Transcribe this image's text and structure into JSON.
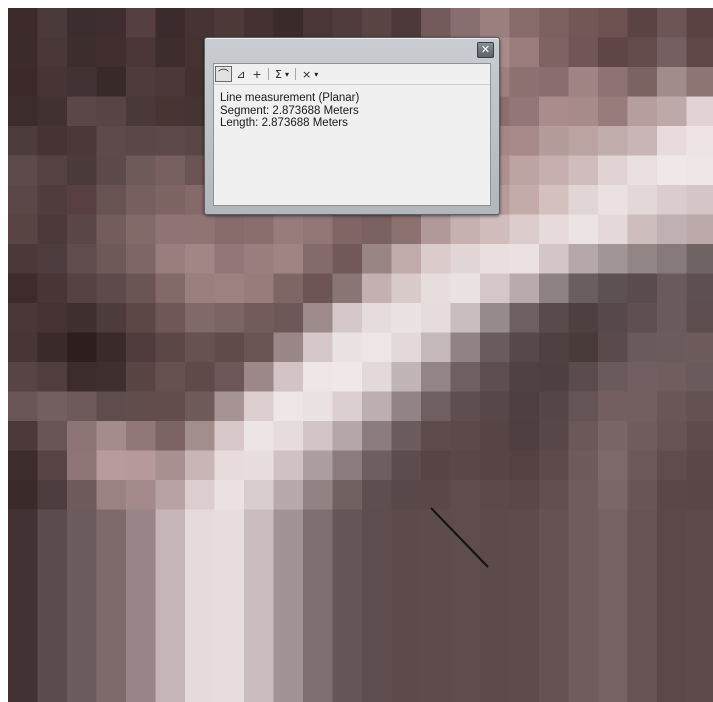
{
  "measure_window": {
    "close_glyph": "✕",
    "toolbar": {
      "line_tool_glyph": "⌒",
      "area_tool_glyph": "⊿",
      "feature_tool_glyph": "+",
      "sum_glyph": "Σ",
      "dropdown_glyph": "▾",
      "clear_glyph": "×"
    },
    "results": {
      "title": "Line measurement (Planar)",
      "segment": "Segment: 2.873688 Meters",
      "length": "Length: 2.873688 Meters"
    }
  },
  "map": {
    "cell_colors": [
      "#3d2b2b",
      "#4b3a3a",
      "#3b2c2d",
      "#3f2e2f",
      "#553f40",
      "#3c2b2c",
      "#463434",
      "#4f3a3a",
      "#443233",
      "#3a2b2a",
      "#4a3636",
      "#503c3c",
      "#5a4444",
      "#4e3a3a",
      "#735b5c",
      "#896e6f",
      "#9b7f7f",
      "#876a6a",
      "#7d6060",
      "#735656",
      "#6d5050",
      "#5b4344",
      "#6d5556",
      "#5a4243",
      "#3b2b2b",
      "#4a3839",
      "#3d2d2d",
      "#412f30",
      "#4a3636",
      "#3e2d2d",
      "#453333",
      "#4e3939",
      "#433132",
      "#3c2c2c",
      "#4d3939",
      "#4e3a3b",
      "#574141",
      "#564041",
      "#6e5555",
      "#8b6e6e",
      "#a78a89",
      "#9b7c7c",
      "#7f6363",
      "#725556",
      "#5f4546",
      "#634a4b",
      "#765f60",
      "#5f4748",
      "#3c2a2b",
      "#473536",
      "#433233",
      "#392a2a",
      "#4e3c3c",
      "#4b3838",
      "#433132",
      "#4e3a3a",
      "#4b3838",
      "#4a3737",
      "#574242",
      "#5d4646",
      "#5b4545",
      "#6b5353",
      "#7b6060",
      "#927575",
      "#9d8181",
      "#8d7171",
      "#8a6d6e",
      "#a18585",
      "#8f7374",
      "#7d6262",
      "#a18b8b",
      "#8d7574",
      "#3d2c2c",
      "#413131",
      "#5a4747",
      "#574444",
      "#4a3939",
      "#473534",
      "#453434",
      "#4f3b3b",
      "#533f3f",
      "#5b4545",
      "#594343",
      "#5d4747",
      "#735a5a",
      "#634c4c",
      "#6a5252",
      "#7f6465",
      "#8b6f6f",
      "#937677",
      "#a98c8b",
      "#a78b8a",
      "#987c7b",
      "#b69e9e",
      "#bca9a8",
      "#e2d2d3",
      "#4d3c3c",
      "#463434",
      "#4b3939",
      "#5e4a4a",
      "#5a4747",
      "#5c4848",
      "#5a4646",
      "#5a4646",
      "#5c4747",
      "#694f4f",
      "#665050",
      "#6c5555",
      "#765d5d",
      "#7d6262",
      "#866a69",
      "#9d8181",
      "#a48786",
      "#a78a89",
      "#b59c9b",
      "#bba3a2",
      "#c1adac",
      "#c8b6b6",
      "#e9dbdc",
      "#efe4e5",
      "#5d4b4b",
      "#544242",
      "#4c3b3b",
      "#5c4949",
      "#6f5a5a",
      "#786060",
      "#6b5454",
      "#6e5656",
      "#755c5c",
      "#7d6161",
      "#7b6060",
      "#846869",
      "#8d7070",
      "#9c7f7f",
      "#a58888",
      "#a68988",
      "#ad9191",
      "#bda3a2",
      "#c6afae",
      "#cfbcbc",
      "#e1d3d3",
      "#eae0e0",
      "#f0e7e7",
      "#eee5e6",
      "#5b4747",
      "#4f3d3d",
      "#583f41",
      "#685353",
      "#785f5f",
      "#7f6464",
      "#866a6a",
      "#7a5f5f",
      "#7b6161",
      "#856968",
      "#7b6061",
      "#7f6464",
      "#856969",
      "#9e8282",
      "#b49898",
      "#ad9292",
      "#b69b9b",
      "#c4abaa",
      "#d3c0bf",
      "#e2d5d6",
      "#ebe1e2",
      "#e4d7d8",
      "#dbcccd",
      "#d5c5c6",
      "#5a4545",
      "#4c3a3b",
      "#5a4647",
      "#745c5c",
      "#846969",
      "#907374",
      "#907473",
      "#876b6b",
      "#8a6e6e",
      "#987b7b",
      "#927676",
      "#816565",
      "#7c6162",
      "#8d7170",
      "#b1999a",
      "#c6b0b0",
      "#d0bcbb",
      "#ddcccc",
      "#e6dada",
      "#ece3e3",
      "#e4d8d9",
      "#cdbdbd",
      "#c1b0b1",
      "#bca9aa",
      "#4b3839",
      "#4e3d3e",
      "#5f4c4c",
      "#6f5858",
      "#806566",
      "#9a7d7d",
      "#a28585",
      "#937677",
      "#9a7e7e",
      "#a08383",
      "#856a6b",
      "#735a5a",
      "#9a8585",
      "#c0aaaa",
      "#dccbcb",
      "#e3d6d6",
      "#e9dfe0",
      "#ebe1e2",
      "#d4c6c7",
      "#b6a7a8",
      "#a19595",
      "#928585",
      "#867a7b",
      "#6f6364",
      "#3e2c2c",
      "#483536",
      "#554242",
      "#5d4a4a",
      "#6b5454",
      "#846969",
      "#9b7e7e",
      "#9d8181",
      "#987c7c",
      "#7f6564",
      "#6d5556",
      "#8a7575",
      "#c3b0b0",
      "#dacbcb",
      "#e8dddd",
      "#ebe2e2",
      "#d5c7c8",
      "#b9aaab",
      "#8e8182",
      "#6b5e5f",
      "#5e5151",
      "#5a4b4c",
      "#6a5a5b",
      "#5e4f50",
      "#4a3839",
      "#453334",
      "#3f2f2f",
      "#4d3c3c",
      "#5c4646",
      "#6f5757",
      "#816869",
      "#7d6464",
      "#735b5b",
      "#6e5757",
      "#9d8a8a",
      "#d6c8c8",
      "#e6dcdc",
      "#ebe2e3",
      "#e6dcdd",
      "#c9bcbc",
      "#978a8a",
      "#6e6061",
      "#594b4c",
      "#4e3f40",
      "#574849",
      "#5f4f50",
      "#6b5a5b",
      "#5d4d4e",
      "#483636",
      "#3a2a29",
      "#2e1f1e",
      "#3a2a29",
      "#4f3d3d",
      "#5c4747",
      "#685151",
      "#614a4a",
      "#6a5454",
      "#9a8787",
      "#d5c7c7",
      "#ebe2e2",
      "#ede5e6",
      "#e4d9da",
      "#c5b8b9",
      "#918383",
      "#6a5c5d",
      "#574949",
      "#4f4041",
      "#4a3b3b",
      "#5a4a4b",
      "#6b5a5b",
      "#6c5b5c",
      "#6e5c5d",
      "#574546",
      "#503e3e",
      "#3c2c2b",
      "#3f2f2e",
      "#5a4545",
      "#665050",
      "#5f4949",
      "#6c5657",
      "#9c8889",
      "#d3c3c4",
      "#eee5e6",
      "#efe7e8",
      "#e3d9da",
      "#c2b5b6",
      "#938586",
      "#705f60",
      "#5e4e4f",
      "#504142",
      "#4e3f40",
      "#5b4b4c",
      "#6a5a5b",
      "#725f61",
      "#705e5f",
      "#6b5a5b",
      "#6a5657",
      "#735f60",
      "#6e5a5b",
      "#5f4c4d",
      "#624d4d",
      "#624c4c",
      "#705b5b",
      "#a69394",
      "#dccdce",
      "#eee6e7",
      "#ebe2e3",
      "#dccfd0",
      "#bdaeaf",
      "#928384",
      "#6f5f60",
      "#5f4e4f",
      "#574748",
      "#4f3f40",
      "#564647",
      "#655455",
      "#735f60",
      "#725f60",
      "#695758",
      "#645252",
      "#4c3a3a",
      "#6a5556",
      "#8d7576",
      "#a58b8c",
      "#927778",
      "#7c6465",
      "#a38e8e",
      "#d8c8c9",
      "#ede4e5",
      "#e6dcdd",
      "#d3c5c6",
      "#b5a6a7",
      "#8c7c7d",
      "#6d5c5d",
      "#5e4c4d",
      "#5c4a4b",
      "#574546",
      "#4f3e3f",
      "#584748",
      "#6b595a",
      "#7a6667",
      "#6f5c5d",
      "#675556",
      "#5e4c4d",
      "#3d2c2c",
      "#574444",
      "#8e7677",
      "#b89c9d",
      "#b79b9c",
      "#a99091",
      "#c8b5b6",
      "#e7dbdc",
      "#e8dedf",
      "#d0c2c3",
      "#ad9e9f",
      "#8c7c7d",
      "#6f5e5f",
      "#5d4c4d",
      "#574546",
      "#5a4748",
      "#574445",
      "#544243",
      "#5d4b4c",
      "#6e5c5d",
      "#7e696a",
      "#6c595a",
      "#5f4d4e",
      "#5a4849",
      "#3a2a29",
      "#4e3d3e",
      "#6e5b5b",
      "#9a8282",
      "#a48a8b",
      "#b8a2a3",
      "#dccdce",
      "#ece2e3",
      "#dacdce",
      "#b8a9aa",
      "#928283",
      "#716161",
      "#5f4e4f",
      "#594849",
      "#5a4849",
      "#5f4c4d",
      "#5c494a",
      "#5a4748",
      "#625051",
      "#6f5d5e",
      "#7b6767",
      "#685556",
      "#5a4849",
      "#594748",
      "#433233",
      "#5c4b4c",
      "#6c5b5c",
      "#7d6b6c",
      "#97858a",
      "#c6b6b8",
      "#e6dadb",
      "#e8dddf",
      "#cbbdbe",
      "#a29394",
      "#7e6e6f",
      "#665556",
      "#5e4d4e",
      "#5d4b4c",
      "#5e4c4d",
      "#5f4c4d",
      "#5d4a4b",
      "#5e4b4c",
      "#655253",
      "#6f5c5d",
      "#766263",
      "#665354",
      "#5b4949",
      "#5d4b4c"
    ]
  }
}
